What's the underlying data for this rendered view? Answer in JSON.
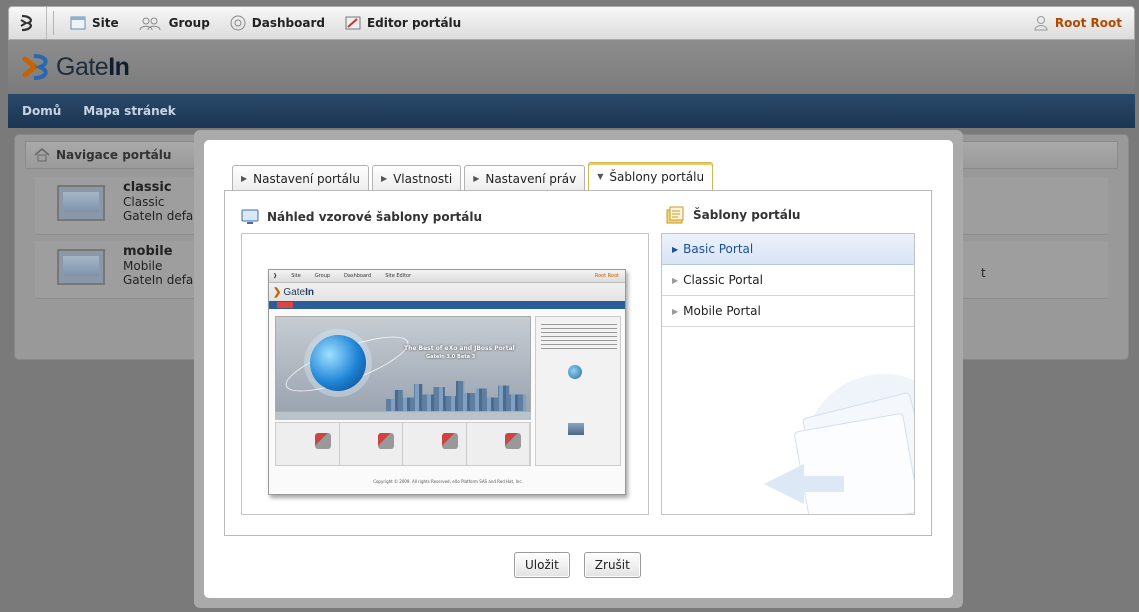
{
  "toolbar": {
    "site": "Site",
    "group": "Group",
    "dashboard": "Dashboard",
    "editor": "Editor portálu",
    "user": "Root Root"
  },
  "brand": {
    "name_light": "Gate",
    "name_bold": "In"
  },
  "nav": {
    "home": "Domů",
    "sitemap": "Mapa stránek"
  },
  "portal_nav": {
    "title": "Navigace portálu",
    "rows": [
      {
        "name": "classic",
        "label": "Classic",
        "desc": "GateIn defau"
      },
      {
        "name": "mobile",
        "label": "Mobile",
        "desc": "GateIn defau"
      }
    ],
    "stray": "t"
  },
  "dialog": {
    "tabs": [
      {
        "label": "Nastavení portálu"
      },
      {
        "label": "Vlastnosti"
      },
      {
        "label": "Nastavení práv"
      },
      {
        "label": "Šablony portálu"
      }
    ],
    "preview_title": "Náhled vzorové šablony portálu",
    "templates_title": "Šablony portálu",
    "templates": [
      {
        "label": "Basic Portal",
        "selected": true
      },
      {
        "label": "Classic Portal",
        "selected": false
      },
      {
        "label": "Mobile Portal",
        "selected": false
      }
    ],
    "save": "Uložit",
    "cancel": "Zrušit"
  },
  "colors": {
    "accent": "#1b3554",
    "user": "#b04a00",
    "tab_active": "#d8b24c",
    "selected": "#1c4f9a"
  }
}
